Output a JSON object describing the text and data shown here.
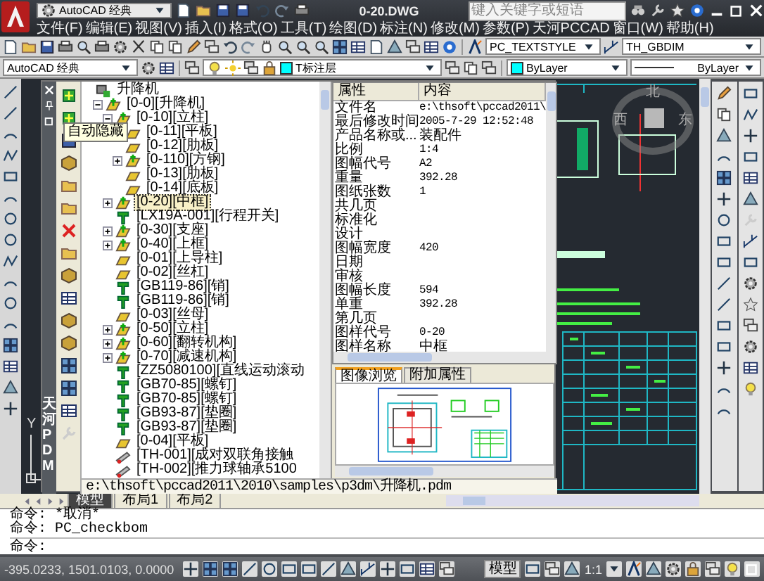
{
  "title_bar": {
    "workspace": "AutoCAD 经典",
    "title": "0-20.DWG",
    "search": {
      "placeholder": "键入关键字或短语"
    }
  },
  "menu": [
    "文件(F)",
    "编辑(E)",
    "视图(V)",
    "插入(I)",
    "格式(O)",
    "工具(T)",
    "绘图(D)",
    "标注(N)",
    "修改(M)",
    "参数(P)",
    "天河PCCAD",
    "窗口(W)",
    "帮助(H)"
  ],
  "toolbars": {
    "text_style": "PC_TEXTSTYLE",
    "dim_style": "TH_GBDIM",
    "workspace": "AutoCAD 经典",
    "layer": "T标注层",
    "color_control": "ByLayer",
    "linetype": "ByLayer"
  },
  "pdm_panel": {
    "side_label": "天河PDM",
    "tooltip": "自动隐藏",
    "tree": [
      {
        "label": "升降机",
        "kind": "root",
        "selected": false,
        "children": [
          {
            "label": "[0-0][升降机]",
            "kind": "assembly",
            "expanded": true,
            "selected": false,
            "children": [
              {
                "label": "[0-10][立柱]",
                "kind": "assembly",
                "expanded": true,
                "selected": false,
                "children": [
                  {
                    "label": "[0-11][平板]",
                    "kind": "part",
                    "selected": false
                  },
                  {
                    "label": "[0-12][肋板]",
                    "kind": "part",
                    "selected": false
                  },
                  {
                    "label": "[0-110][方钢]",
                    "kind": "assembly",
                    "expanded": false,
                    "selected": false
                  },
                  {
                    "label": "[0-13][肋板]",
                    "kind": "part",
                    "selected": false
                  },
                  {
                    "label": "[0-14][底板]",
                    "kind": "part",
                    "selected": false
                  }
                ]
              },
              {
                "label": "[0-20][中框]",
                "kind": "assembly",
                "expanded": false,
                "selected": true
              },
              {
                "label": "[LX19A-001][行程开关]",
                "kind": "standard",
                "selected": false
              },
              {
                "label": "[0-30][支座]",
                "kind": "assembly",
                "expanded": false,
                "selected": false
              },
              {
                "label": "[0-40][上框]",
                "kind": "assembly",
                "expanded": false,
                "selected": false
              },
              {
                "label": "[0-01][上导柱]",
                "kind": "part",
                "selected": false
              },
              {
                "label": "[0-02][丝杠]",
                "kind": "part",
                "selected": false
              },
              {
                "label": "[GB119-86][销]",
                "kind": "standard",
                "selected": false
              },
              {
                "label": "[GB119-86][销]",
                "kind": "standard",
                "selected": false
              },
              {
                "label": "[0-03][丝母]",
                "kind": "part",
                "selected": false
              },
              {
                "label": "[0-50][立柱]",
                "kind": "assembly",
                "expanded": false,
                "selected": false
              },
              {
                "label": "[0-60][翻转机构]",
                "kind": "assembly",
                "expanded": false,
                "selected": false
              },
              {
                "label": "[0-70][减速机构]",
                "kind": "assembly",
                "expanded": false,
                "selected": false
              },
              {
                "label": "[ZZ5080100][直线运动滚动",
                "kind": "standard",
                "selected": false
              },
              {
                "label": "[GB70-85][螺钉]",
                "kind": "standard",
                "selected": false
              },
              {
                "label": "[GB70-85][螺钉]",
                "kind": "standard",
                "selected": false
              },
              {
                "label": "[GB93-87][垫圈]",
                "kind": "standard",
                "selected": false
              },
              {
                "label": "[GB93-87][垫圈]",
                "kind": "standard",
                "selected": false
              },
              {
                "label": "[0-04][平板]",
                "kind": "part",
                "selected": false
              },
              {
                "label": "[TH-001][成对双联角接触",
                "kind": "purchased",
                "selected": false
              },
              {
                "label": "[TH-002][推力球轴承5100",
                "kind": "purchased",
                "selected": false
              }
            ]
          }
        ]
      }
    ],
    "properties": {
      "columns": [
        "属性",
        "内容"
      ],
      "rows": [
        {
          "name": "文件名",
          "value": "e:\\thsoft\\pccad2011\\"
        },
        {
          "name": "最后修改时间",
          "value": "2005-7-29 12:52:48"
        },
        {
          "name": "产品名称或...",
          "value": "装配件"
        },
        {
          "name": "比例",
          "value": "1:4"
        },
        {
          "name": "图幅代号",
          "value": "A2"
        },
        {
          "name": "重量",
          "value": "392.28"
        },
        {
          "name": "图纸张数",
          "value": "1"
        },
        {
          "name": "共几页"
        },
        {
          "name": "标准化"
        },
        {
          "name": "设计"
        },
        {
          "name": "图幅宽度",
          "value": "420"
        },
        {
          "name": "日期"
        },
        {
          "name": "审核"
        },
        {
          "name": "图幅长度",
          "value": "594"
        },
        {
          "name": "单重",
          "value": "392.28"
        },
        {
          "name": "第几页"
        },
        {
          "name": "图样代号",
          "value": "0-20"
        },
        {
          "name": "图样名称",
          "value": "中框"
        }
      ]
    },
    "preview_tabs": [
      {
        "label": "图像浏览",
        "selected": true
      },
      {
        "label": "附加属性",
        "selected": false
      }
    ],
    "path": "e:\\thsoft\\pccad2011\\2010\\samples\\p3dm\\升降机.pdm"
  },
  "viewcube": {
    "north": "北",
    "west": "西",
    "east": "东"
  },
  "ucs_label": "Y",
  "layout_tabs": [
    {
      "label": "模型",
      "selected": true
    },
    {
      "label": "布局1",
      "selected": false
    },
    {
      "label": "布局2",
      "selected": false
    }
  ],
  "command_history": [
    "命令: *取消*",
    "命令: PC_checkbom"
  ],
  "command_prompt": "命令:",
  "status_bar": {
    "coordinates": "-395.0233, 1501.0103, 0.0000",
    "model_button": "模型",
    "scale": "1:1"
  }
}
